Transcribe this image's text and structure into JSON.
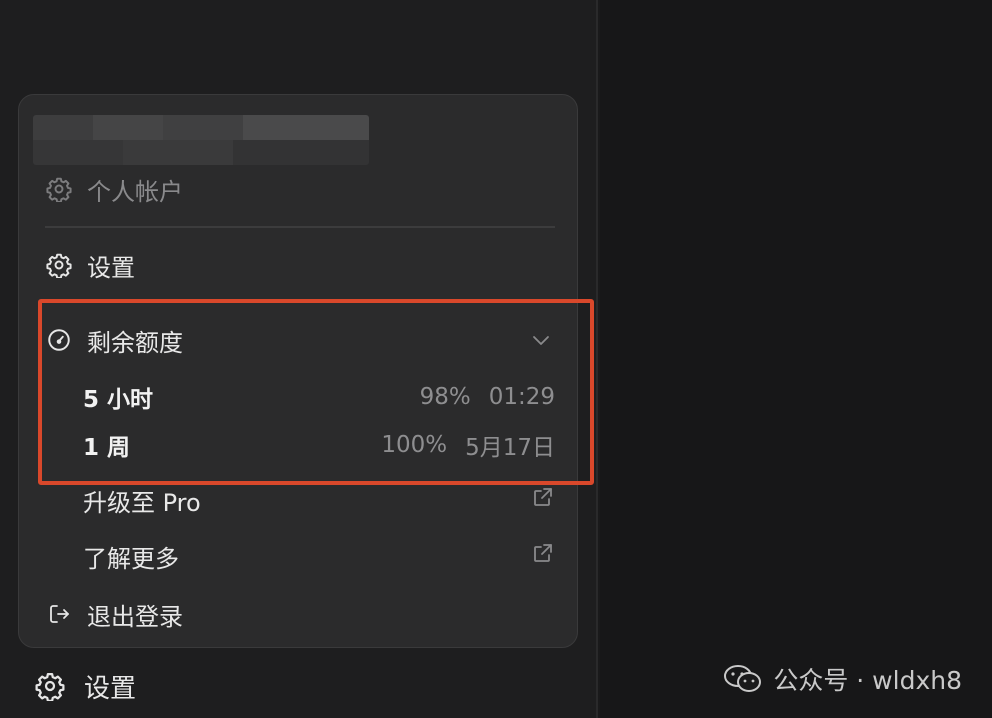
{
  "account_menu": {
    "account_label": "个人帐户",
    "settings_label": "设置",
    "quota": {
      "title": "剩余额度",
      "items": [
        {
          "name": "5 小时",
          "percent": "98%",
          "reset": "01:29"
        },
        {
          "name": "1 周",
          "percent": "100%",
          "reset": "5月17日"
        }
      ]
    },
    "upgrade_label": "升级至 Pro",
    "learn_more_label": "了解更多",
    "logout_label": "退出登录"
  },
  "sidebar": {
    "settings_label": "设置"
  },
  "watermark": {
    "text": "公众号 · wldxh8"
  },
  "colors": {
    "highlight": "#d9482b",
    "menu_bg": "#2b2b2c",
    "background": "#1a1a1b"
  }
}
